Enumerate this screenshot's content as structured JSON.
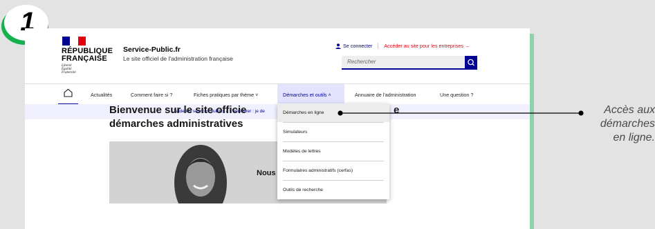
{
  "step": {
    "number": "1"
  },
  "header": {
    "republique": "RÉPUBLIQUE\nFRANÇAISE",
    "motto": "Liberté\nÉgalité\nFraternité",
    "site_title": "Service-Public.fr",
    "site_subtitle": "Le site officiel de l'administration française",
    "connect": "Se connecter",
    "business_link": "Accéder au site pour les entreprises →",
    "search_placeholder": "Rechercher"
  },
  "nav": {
    "items": [
      "Actualités",
      "Comment faire si ?",
      "Fiches pratiques par thème ˅",
      "Démarches et outils ˄",
      "Annuaire de l'administration",
      "Une question ?"
    ]
  },
  "banner": {
    "text": "J'aide les services publics à s'améliorer : je de"
  },
  "main": {
    "welcome": "Bienvenue sur le site officie\ndémarches administratives",
    "welcome_suffix": "e",
    "photo_caption": "Nous vous guidons"
  },
  "dropdown": {
    "items": [
      "Démarches en ligne",
      "Simulateurs",
      "Modèles de lettres",
      "Formulaires administratifs (cerfas)",
      "Outils de recherche"
    ]
  },
  "callout": {
    "text": "Accès aux\ndémarches\nen ligne."
  },
  "colors": {
    "accent": "#000091",
    "red": "#e1000f",
    "green": "#16b14f"
  }
}
